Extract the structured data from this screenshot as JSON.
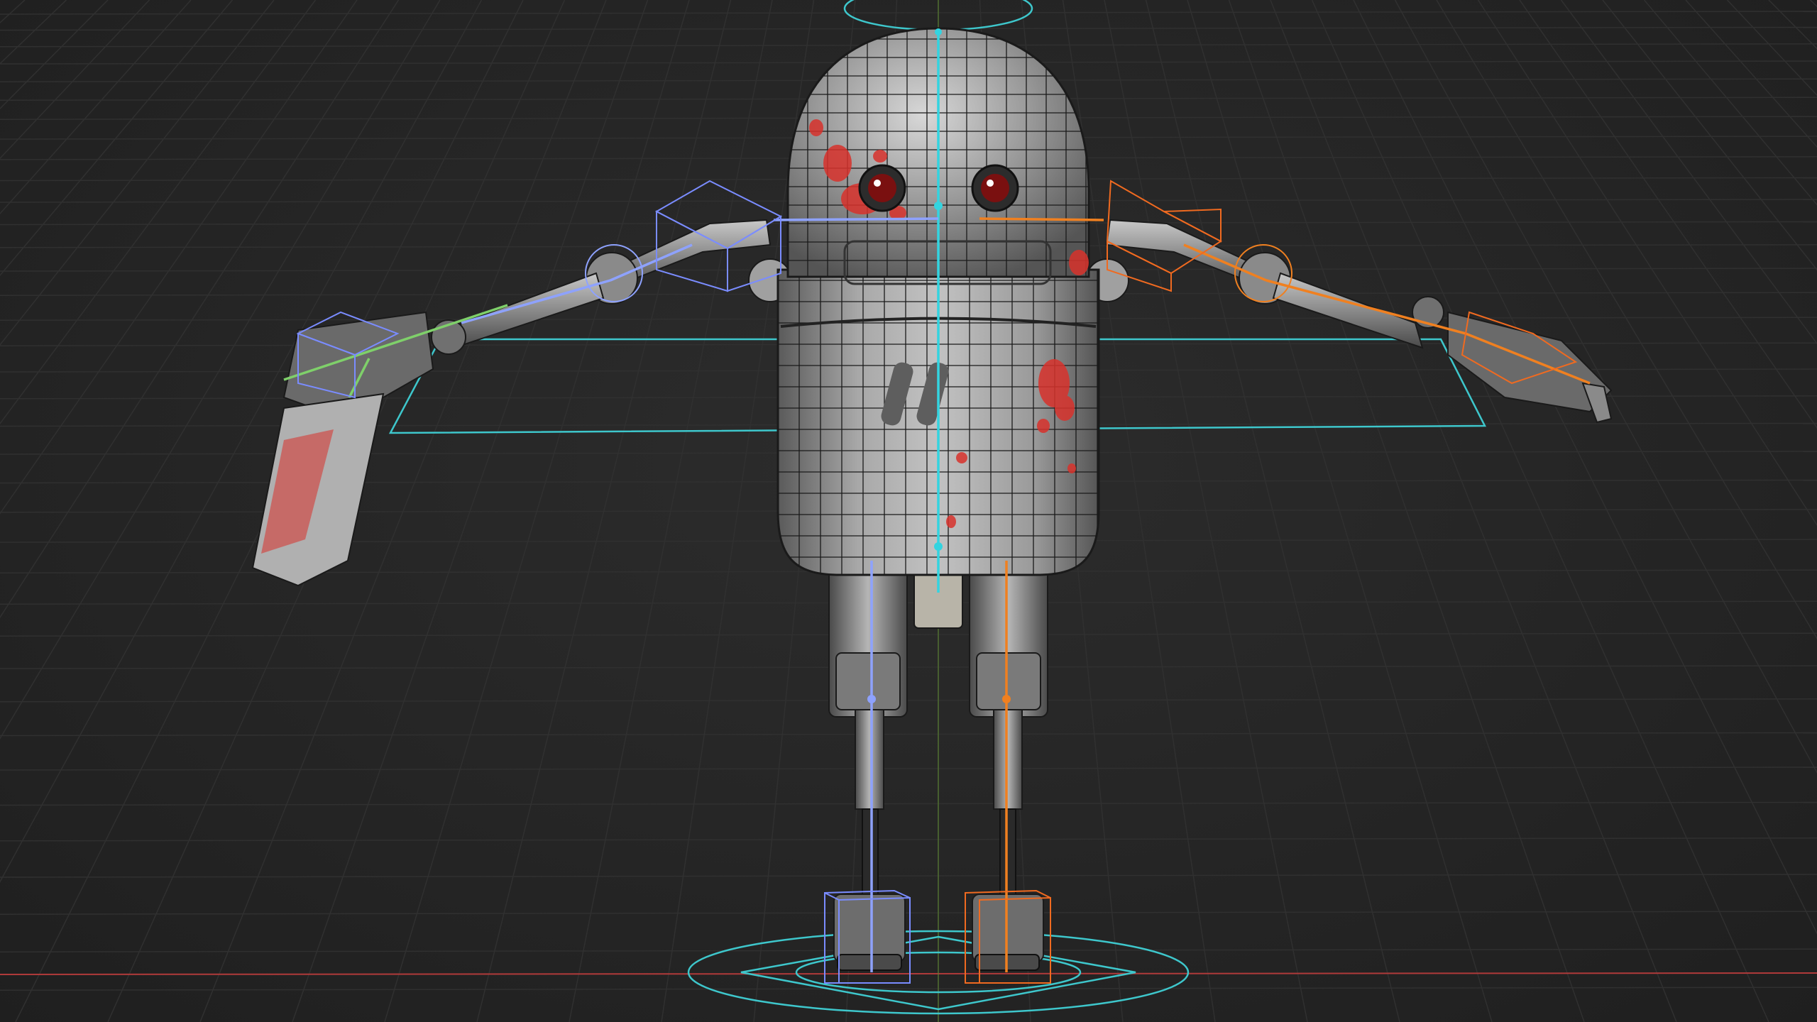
{
  "viewport": {
    "mode": "3d-viewport",
    "background_color": "#242424",
    "grid_color": "#2f2f2f",
    "x_axis_color": "#b03a3a",
    "y_axis_color": "#6f9f3a"
  },
  "scene": {
    "object": "robot-character",
    "mesh_color": "#8f8f8f",
    "mesh_wire_color": "#1a1a1a",
    "paint_splatter_color": "#d8322c",
    "eye_color": "#7a1010"
  },
  "armature": {
    "center_bone_color": "#33d4e0",
    "left_bone_color": "#8ea2ff",
    "right_bone_color": "#f08020",
    "control_curve_color": "#3ec7cc",
    "hand_bone_color": "#7fd06a"
  }
}
